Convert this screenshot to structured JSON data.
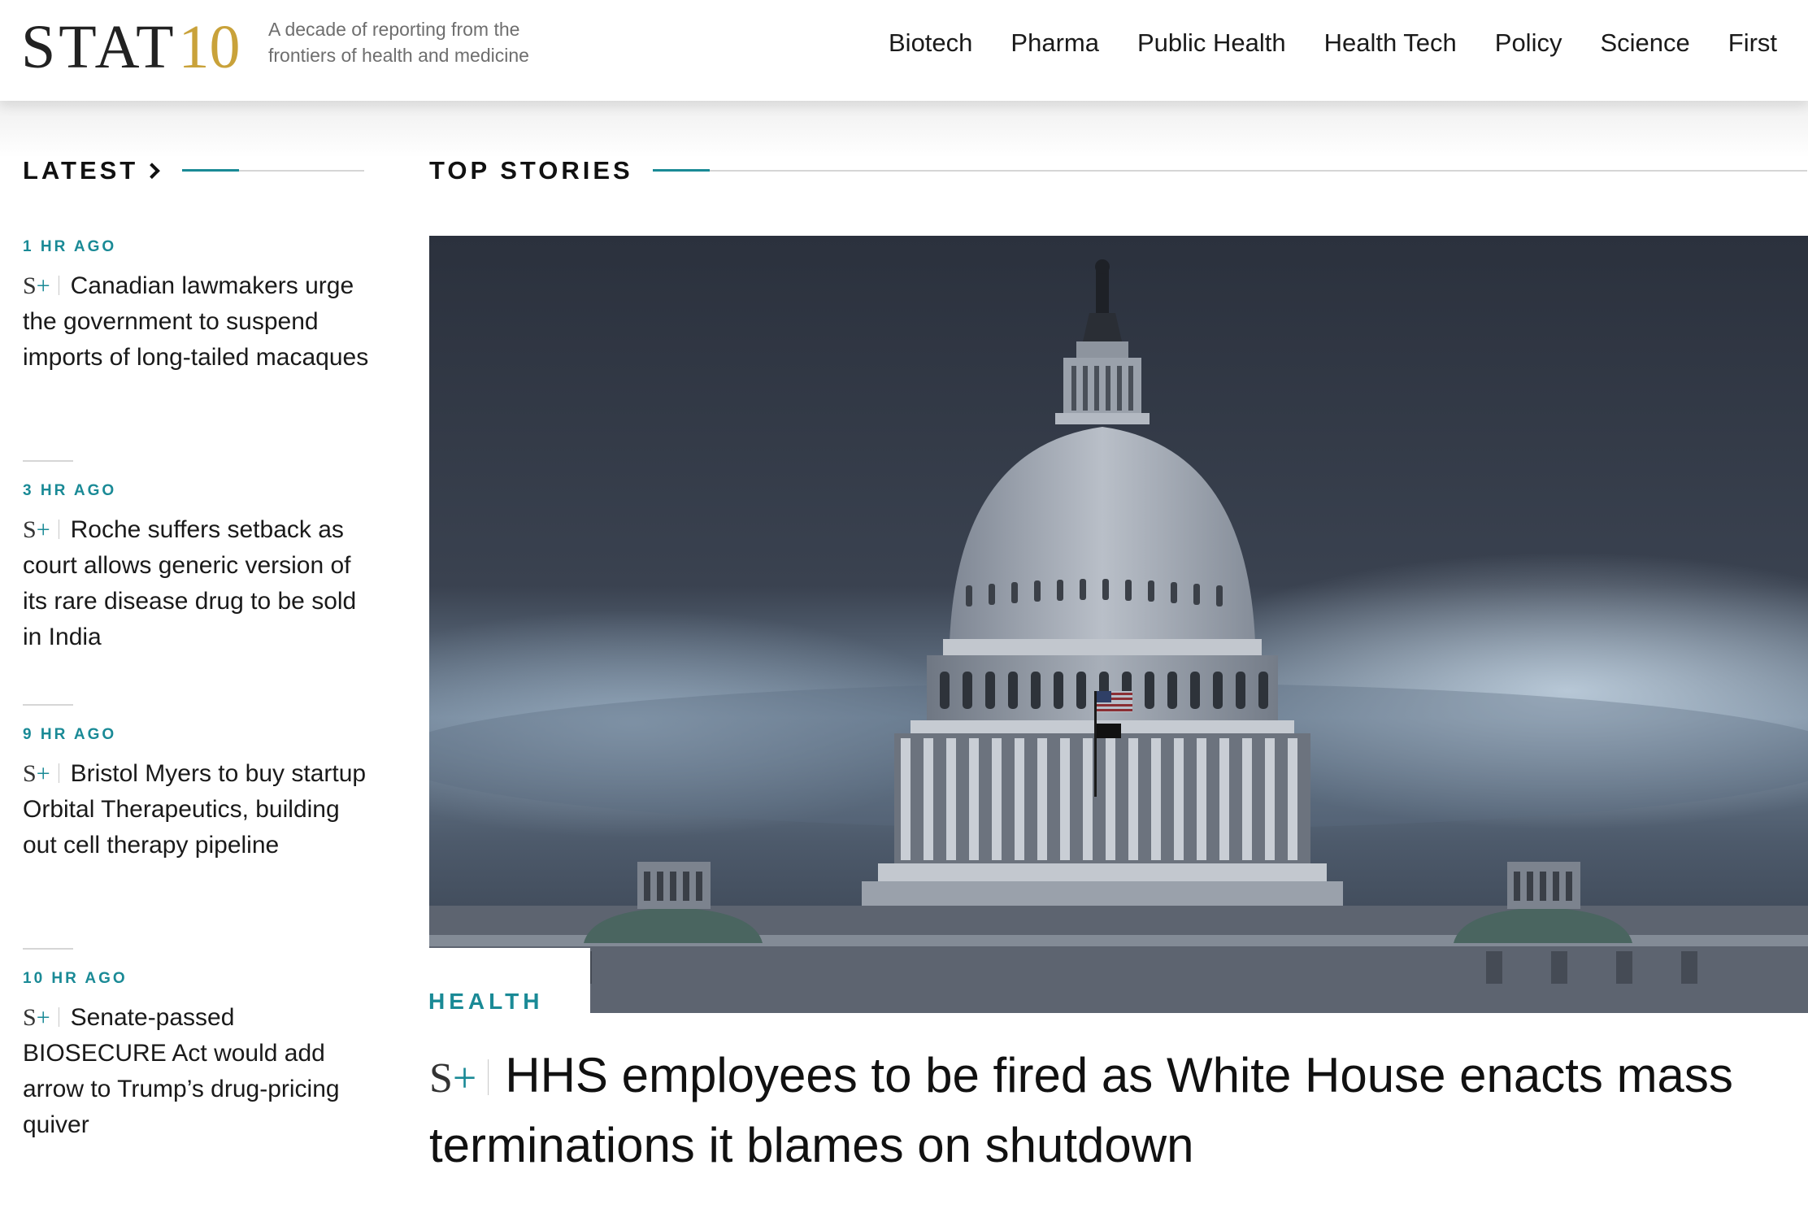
{
  "header": {
    "logo_main": "STAT",
    "logo_number": "10",
    "tagline": "A decade of reporting from the frontiers of health and medicine",
    "nav": [
      "Biotech",
      "Pharma",
      "Public Health",
      "Health Tech",
      "Policy",
      "Science",
      "First"
    ]
  },
  "latest": {
    "title": "LATEST",
    "items": [
      {
        "time": "1 HR AGO",
        "badge": "S+",
        "headline": "Canadian lawmakers urge the government to suspend imports of long-tailed macaques"
      },
      {
        "time": "3 HR AGO",
        "badge": "S+",
        "headline": "Roche suffers setback as court allows generic version of its rare disease drug to be sold in India"
      },
      {
        "time": "9 HR AGO",
        "badge": "S+",
        "headline": "Bristol Myers to buy startup Orbital Therapeutics, building out cell therapy pipeline"
      },
      {
        "time": "10 HR AGO",
        "badge": "S+",
        "headline": "Senate-passed BIOSECURE Act would add arrow to Trump’s drug-pricing quiver"
      }
    ]
  },
  "top_stories": {
    "title": "TOP STORIES",
    "hero": {
      "category": "HEALTH",
      "badge": "S+",
      "headline": "HHS employees to be fired as White House enacts mass terminations it blames on shutdown"
    }
  },
  "colors": {
    "accent": "#1a8a96",
    "logo_gold": "#c9a23a",
    "text": "#1a1a1a"
  }
}
